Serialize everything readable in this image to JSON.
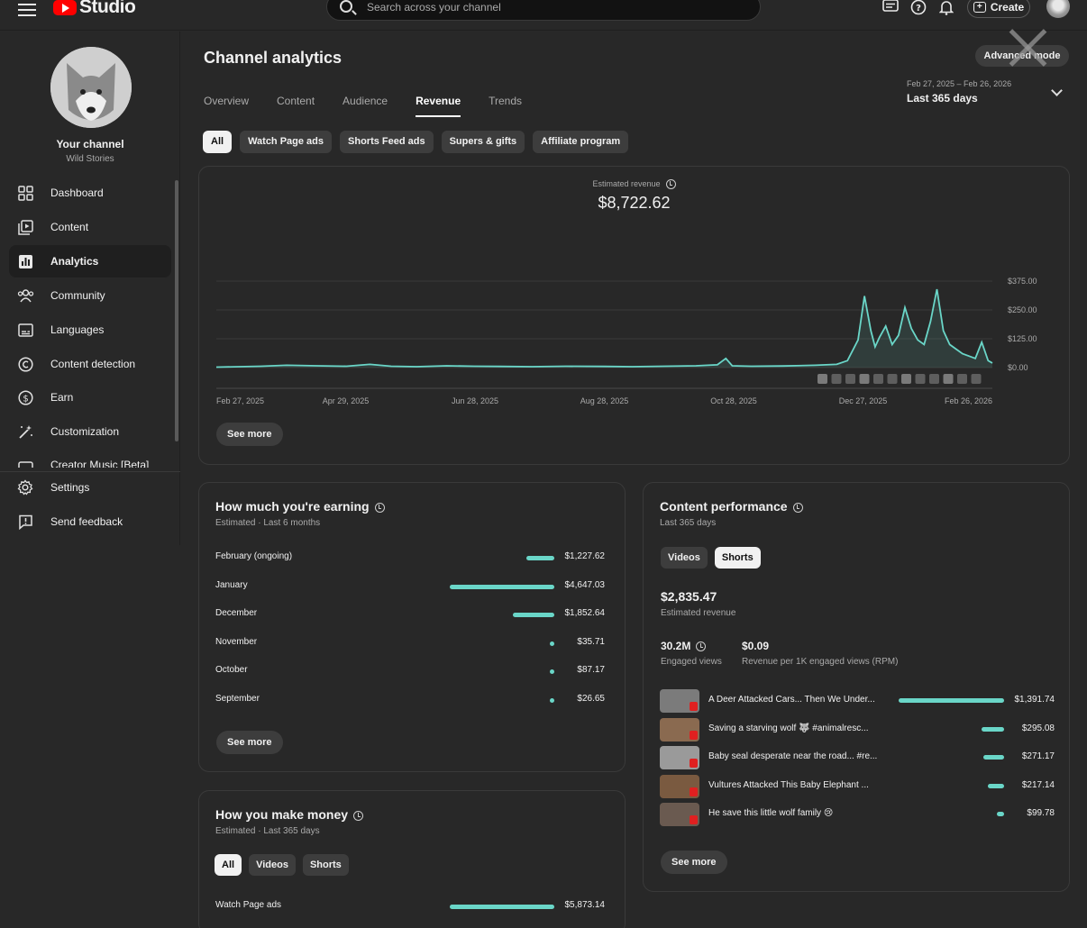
{
  "topbar": {
    "logo_text": "Studio",
    "search_placeholder": "Search across your channel",
    "create_label": "Create"
  },
  "sidebar": {
    "channel_name": "Your channel",
    "channel_sub": "Wild Stories",
    "items": [
      {
        "label": "Dashboard",
        "icon": "dashboard-icon"
      },
      {
        "label": "Content",
        "icon": "content-icon"
      },
      {
        "label": "Analytics",
        "icon": "analytics-icon",
        "active": true
      },
      {
        "label": "Community",
        "icon": "community-icon"
      },
      {
        "label": "Languages",
        "icon": "languages-icon"
      },
      {
        "label": "Content detection",
        "icon": "copyright-icon"
      },
      {
        "label": "Earn",
        "icon": "dollar-icon"
      },
      {
        "label": "Customization",
        "icon": "magic-wand-icon"
      },
      {
        "label": "Creator Music [Beta]",
        "icon": "music-icon"
      }
    ],
    "footer": [
      {
        "label": "Settings",
        "icon": "gear-icon"
      },
      {
        "label": "Send feedback",
        "icon": "feedback-icon"
      }
    ]
  },
  "header": {
    "title": "Channel analytics",
    "advanced_mode": "Advanced mode",
    "tabs": [
      "Overview",
      "Content",
      "Audience",
      "Revenue",
      "Trends"
    ],
    "active_tab": "Revenue",
    "date_range": "Feb 27, 2025 – Feb 26, 2026",
    "date_preset": "Last 365 days"
  },
  "filters": [
    "All",
    "Watch Page ads",
    "Shorts Feed ads",
    "Supers & gifts",
    "Affiliate program"
  ],
  "revenue_card": {
    "label": "Estimated revenue",
    "value": "$8,722.62",
    "see_more": "See more"
  },
  "chart_data": {
    "type": "line",
    "title": "",
    "x_tick_labels": [
      "Feb 27, 2025",
      "Apr 29, 2025",
      "Jun 28, 2025",
      "Aug 28, 2025",
      "Oct 28, 2025",
      "Dec 27, 2025",
      "Feb 26, 2026"
    ],
    "y_tick_labels": [
      "$375.00",
      "$250.00",
      "$125.00",
      "$0.00"
    ],
    "ylim": [
      0,
      375
    ],
    "grid": true,
    "series": [
      {
        "color": "#6ad6c8",
        "x": [
          "2025-02-27",
          "2025-03-10",
          "2025-03-20",
          "2025-04-01",
          "2025-04-15",
          "2025-04-29",
          "2025-05-10",
          "2025-05-20",
          "2025-06-01",
          "2025-06-15",
          "2025-06-28",
          "2025-07-10",
          "2025-07-25",
          "2025-08-10",
          "2025-08-28",
          "2025-09-10",
          "2025-09-25",
          "2025-10-10",
          "2025-10-20",
          "2025-10-24",
          "2025-10-27",
          "2025-11-05",
          "2025-11-20",
          "2025-12-05",
          "2025-12-15",
          "2025-12-20",
          "2025-12-25",
          "2025-12-28",
          "2025-12-31",
          "2026-01-02",
          "2026-01-04",
          "2026-01-07",
          "2026-01-10",
          "2026-01-13",
          "2026-01-16",
          "2026-01-19",
          "2026-01-22",
          "2026-01-25",
          "2026-01-28",
          "2026-01-31",
          "2026-02-03",
          "2026-02-06",
          "2026-02-09",
          "2026-02-12",
          "2026-02-15",
          "2026-02-18",
          "2026-02-21",
          "2026-02-24",
          "2026-02-26"
        ],
        "values": [
          2,
          4,
          6,
          10,
          8,
          6,
          14,
          6,
          4,
          8,
          6,
          5,
          4,
          6,
          5,
          4,
          6,
          8,
          12,
          40,
          8,
          6,
          7,
          10,
          14,
          30,
          120,
          310,
          160,
          90,
          130,
          180,
          100,
          140,
          260,
          170,
          120,
          100,
          200,
          340,
          160,
          100,
          80,
          60,
          50,
          40,
          110,
          30,
          20
        ]
      }
    ]
  },
  "earning_card": {
    "title": "How much you're earning",
    "subtitle": "Estimated · Last 6 months",
    "rows": [
      {
        "label": "February (ongoing)",
        "value": "$1,227.62",
        "amount": 1227.62
      },
      {
        "label": "January",
        "value": "$4,647.03",
        "amount": 4647.03
      },
      {
        "label": "December",
        "value": "$1,852.64",
        "amount": 1852.64
      },
      {
        "label": "November",
        "value": "$35.71",
        "amount": 35.71
      },
      {
        "label": "October",
        "value": "$87.17",
        "amount": 87.17
      },
      {
        "label": "September",
        "value": "$26.65",
        "amount": 26.65
      }
    ],
    "see_more": "See more"
  },
  "money_card": {
    "title": "How you make money",
    "subtitle": "Estimated · Last 365 days",
    "chips": [
      "All",
      "Videos",
      "Shorts"
    ],
    "rows": [
      {
        "label": "Watch Page ads",
        "value": "$5,873.14",
        "amount": 5873.14
      }
    ]
  },
  "content_card": {
    "title": "Content performance",
    "subtitle": "Last 365 days",
    "chips": [
      "Videos",
      "Shorts"
    ],
    "revenue": "$2,835.47",
    "revenue_label": "Estimated revenue",
    "views": "30.2M",
    "views_label": "Engaged views",
    "rpm": "$0.09",
    "rpm_label": "Revenue per 1K engaged views (RPM)",
    "items": [
      {
        "title": "A Deer Attacked Cars... Then We Under...",
        "value": "$1,391.74",
        "amount": 1391.74
      },
      {
        "title": "Saving a starving wolf 🐺 #animalresc...",
        "value": "$295.08",
        "amount": 295.08
      },
      {
        "title": "Baby seal desperate near the road... #re...",
        "value": "$271.17",
        "amount": 271.17
      },
      {
        "title": "Vultures Attacked This Baby Elephant ...",
        "value": "$217.14",
        "amount": 217.14
      },
      {
        "title": "He save this little wolf family 😢",
        "value": "$99.78",
        "amount": 99.78
      }
    ],
    "see_more": "See more"
  }
}
